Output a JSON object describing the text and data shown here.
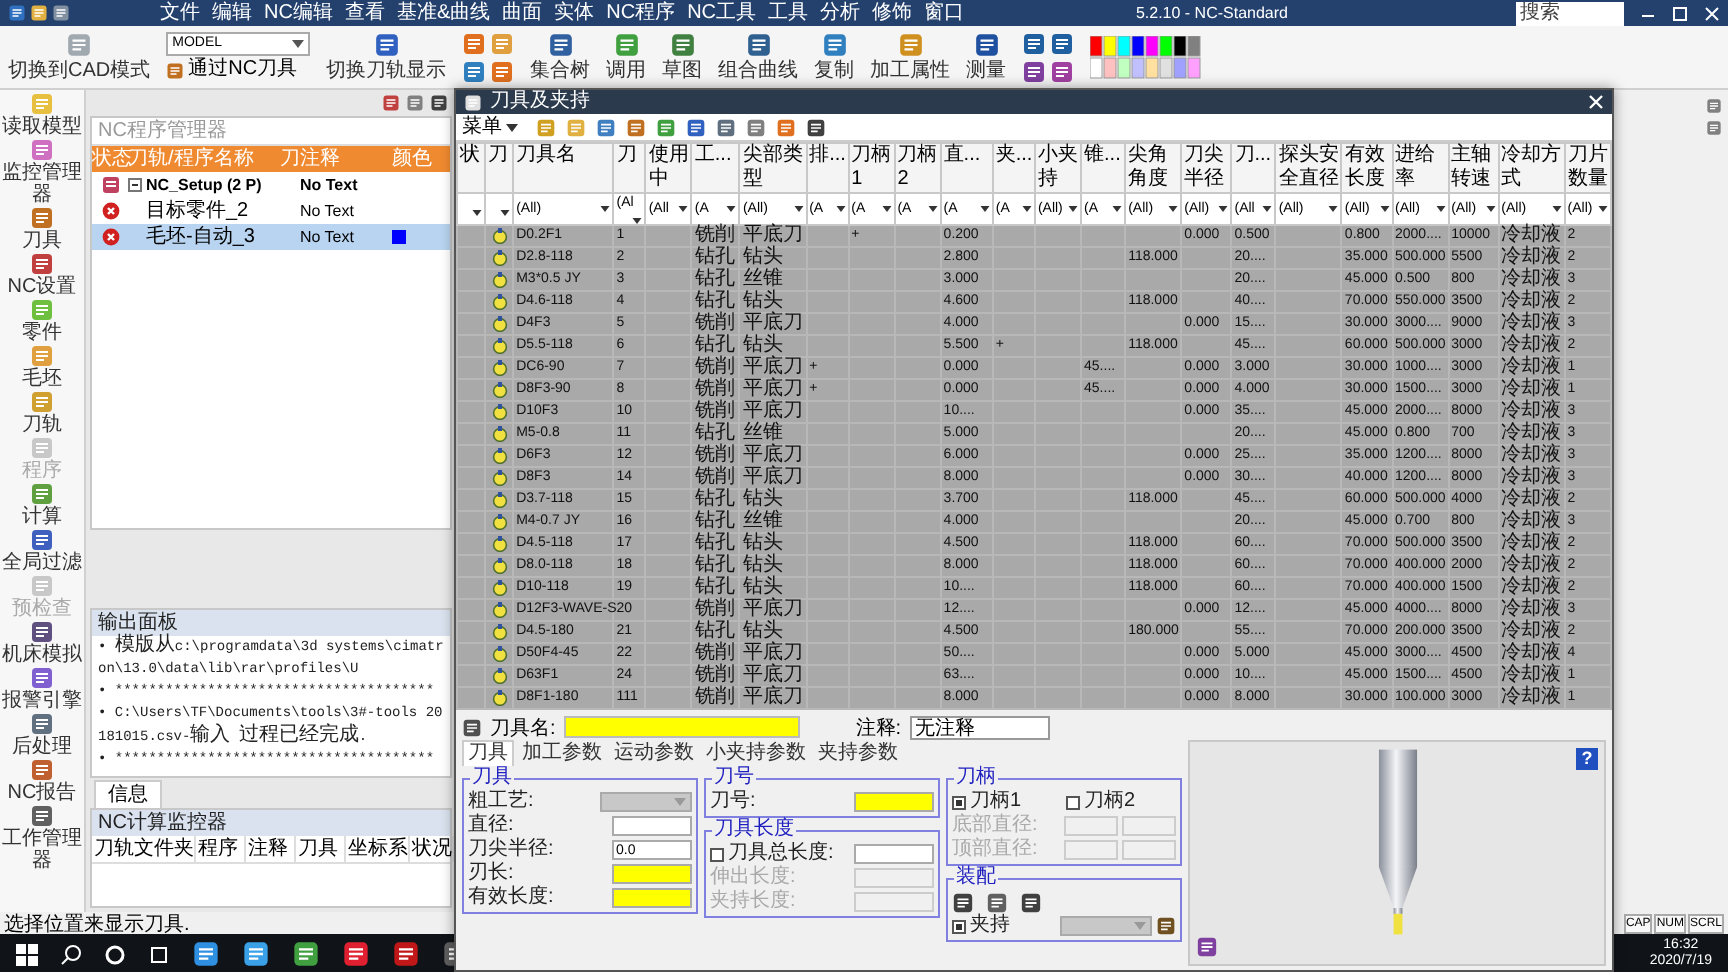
{
  "menu_bar": {
    "items": [
      "文件",
      "编辑",
      "NC编辑",
      "查看",
      "基准&曲线",
      "曲面",
      "实体",
      "NC程序",
      "NC工具",
      "工具",
      "分析",
      "修饰",
      "窗口"
    ],
    "title": "5.2.10 - NC-Standard",
    "search": {
      "placeholder": "搜索"
    }
  },
  "ribbon": {
    "cad_mode_button": "切换到CAD模式",
    "model_select": "MODEL",
    "nc_tool_button": "通过NC刀具",
    "toolpath_display_button": "切换刀轨显示",
    "buttons": [
      "集合树",
      "调用",
      "草图",
      "组合曲线",
      "复制",
      "加工属性",
      "测量"
    ]
  },
  "sidebar": {
    "items": [
      {
        "label": "读取模型",
        "disabled": false
      },
      {
        "label": "监控管理器",
        "disabled": false
      },
      {
        "label": "刀具",
        "disabled": false
      },
      {
        "label": "NC设置",
        "disabled": false
      },
      {
        "label": "零件",
        "disabled": false
      },
      {
        "label": "毛坯",
        "disabled": false
      },
      {
        "label": "刀轨",
        "disabled": false
      },
      {
        "label": "程序",
        "disabled": true
      },
      {
        "label": "计算",
        "disabled": false
      },
      {
        "label": "全局过滤",
        "disabled": false
      },
      {
        "label": "预检查",
        "disabled": true
      },
      {
        "label": "机床模拟",
        "disabled": false
      },
      {
        "label": "报警引擎",
        "disabled": false
      },
      {
        "label": "后处理",
        "disabled": false
      },
      {
        "label": "NC报告",
        "disabled": false
      },
      {
        "label": "工作管理器",
        "disabled": false
      }
    ]
  },
  "nc_program_manager": {
    "title": "NC程序管理器",
    "columns": [
      "状态",
      "刀轨/程序名称",
      "刀",
      "注释",
      "颜色"
    ],
    "rows": [
      {
        "kind": "setup",
        "name": "NC_Setup (2 P)",
        "comment": "No Text",
        "expanded": true,
        "selected": false,
        "children": [
          {
            "kind": "error",
            "name": "目标零件_2",
            "comment": "No Text",
            "selected": false
          },
          {
            "kind": "error",
            "name": "毛坯-自动_3",
            "comment": "No Text",
            "selected": true,
            "color": "#0000ff"
          }
        ]
      }
    ]
  },
  "output_panel": {
    "title": "输出面板",
    "lines": [
      "• 模版从c:\\programdata\\3d systems\\cimatron\\13.0\\data\\lib\\rar\\profiles\\U",
      "• **************************************",
      "• C:\\Users\\TF\\Documents\\tools\\3#-tools 20181015.csv-输入 过程已经完成.",
      "• **************************************"
    ]
  },
  "info_tab": {
    "label": "信息",
    "selected": true
  },
  "nc_monitor": {
    "title": "NC计算监控器",
    "columns": [
      "刀轨文件夹",
      "程序",
      "注释",
      "刀具",
      "坐标系",
      "状况"
    ]
  },
  "status_bar": {
    "message": "选择位置来显示刀具.",
    "indicators": [
      "CAP",
      "NUM",
      "SCRL"
    ]
  },
  "taskbar": {
    "time": "16:32",
    "date": "2020/7/19"
  },
  "tool_dialog": {
    "title": "刀具及夹持",
    "menu_button": "菜单",
    "table": {
      "columns": [
        {
          "label": "状"
        },
        {
          "label": "刀"
        },
        {
          "label": "刀具名",
          "filter": "(All)"
        },
        {
          "label": "刀",
          "filter": "(Al"
        },
        {
          "label": "使用中",
          "filter": "(All"
        },
        {
          "label": "工...",
          "filter": "(A"
        },
        {
          "label": "尖部类型",
          "filter": "(All)"
        },
        {
          "label": "排...",
          "filter": "(A"
        },
        {
          "label": "刀柄1",
          "filter": "(A"
        },
        {
          "label": "刀柄2",
          "filter": "(A"
        },
        {
          "label": "直...",
          "filter": "(A"
        },
        {
          "label": "夹...",
          "filter": "(A"
        },
        {
          "label": "小夹持",
          "filter": "(All)"
        },
        {
          "label": "锥...",
          "filter": "(A"
        },
        {
          "label": "尖角角度",
          "filter": "(All)"
        },
        {
          "label": "刀尖半径",
          "filter": "(All)"
        },
        {
          "label": "刀...",
          "filter": "(All"
        },
        {
          "label": "探头安全直径",
          "filter": "(All)"
        },
        {
          "label": "有效长度",
          "filter": "(All)"
        },
        {
          "label": "进给率",
          "filter": "(All)"
        },
        {
          "label": "主轴转速",
          "filter": "(All)"
        },
        {
          "label": "冷却方式",
          "filter": "(All)"
        },
        {
          "label": "刀片数量",
          "filter": "(All)"
        }
      ],
      "rows": [
        {
          "name": "D0.2F1",
          "number": "1",
          "op": "铣削",
          "tip_type": "平底刀",
          "holder_1": "+",
          "diameter": "0.200",
          "tip_radius": "0.000",
          "column_17": "0.500",
          "effective_length": "0.800",
          "feed_rate": "2000....",
          "spindle_speed": "10000",
          "coolant": "冷却液",
          "flute_count": "2"
        },
        {
          "name": "D2.8-118",
          "number": "2",
          "op": "钻孔",
          "tip_type": "钻头",
          "diameter": "2.800",
          "tip_angle": "118.000",
          "column_17": "20....",
          "effective_length": "35.000",
          "feed_rate": "500.000",
          "spindle_speed": "5500",
          "coolant": "冷却液",
          "flute_count": "2"
        },
        {
          "name": "M3*0.5 JY",
          "number": "3",
          "op": "钻孔",
          "tip_type": "丝锥",
          "diameter": "3.000",
          "column_17": "20....",
          "effective_length": "45.000",
          "feed_rate": "0.500",
          "spindle_speed": "800",
          "coolant": "冷却液",
          "flute_count": "3"
        },
        {
          "name": "D4.6-118",
          "number": "4",
          "op": "钻孔",
          "tip_type": "钻头",
          "diameter": "4.600",
          "tip_angle": "118.000",
          "column_17": "40....",
          "effective_length": "70.000",
          "feed_rate": "550.000",
          "spindle_speed": "3500",
          "coolant": "冷却液",
          "flute_count": "2"
        },
        {
          "name": "D4F3",
          "number": "5",
          "op": "铣削",
          "tip_type": "平底刀",
          "diameter": "4.000",
          "tip_radius": "0.000",
          "column_17": "15....",
          "effective_length": "30.000",
          "feed_rate": "3000....",
          "spindle_speed": "9000",
          "coolant": "冷却液",
          "flute_count": "3"
        },
        {
          "name": "D5.5-118",
          "number": "6",
          "op": "钻孔",
          "tip_type": "钻头",
          "column_12": "+",
          "diameter": "5.500",
          "tip_angle": "118.000",
          "column_17": "45....",
          "effective_length": "60.000",
          "feed_rate": "500.000",
          "spindle_speed": "3000",
          "coolant": "冷却液",
          "flute_count": "2"
        },
        {
          "name": "DC6-90",
          "number": "7",
          "op": "铣削",
          "tip_type": "平底刀",
          "column_8": "+",
          "diameter": "0.000",
          "column_14": "45....",
          "tip_radius": "0.000",
          "column_17": "3.000",
          "effective_length": "30.000",
          "feed_rate": "1000....",
          "spindle_speed": "3000",
          "coolant": "冷却液",
          "flute_count": "1"
        },
        {
          "name": "D8F3-90",
          "number": "8",
          "op": "铣削",
          "tip_type": "平底刀",
          "column_8": "+",
          "diameter": "0.000",
          "column_14": "45....",
          "tip_radius": "0.000",
          "column_17": "4.000",
          "effective_length": "30.000",
          "feed_rate": "1500....",
          "spindle_speed": "3000",
          "coolant": "冷却液",
          "flute_count": "1"
        },
        {
          "name": "D10F3",
          "number": "10",
          "op": "铣削",
          "tip_type": "平底刀",
          "diameter": "10....",
          "tip_radius": "0.000",
          "column_17": "35....",
          "effective_length": "45.000",
          "feed_rate": "2000....",
          "spindle_speed": "8000",
          "coolant": "冷却液",
          "flute_count": "3"
        },
        {
          "name": "M5-0.8",
          "number": "11",
          "op": "钻孔",
          "tip_type": "丝锥",
          "diameter": "5.000",
          "column_17": "20....",
          "effective_length": "45.000",
          "feed_rate": "0.800",
          "spindle_speed": "700",
          "coolant": "冷却液",
          "flute_count": "3"
        },
        {
          "name": "D6F3",
          "number": "12",
          "op": "铣削",
          "tip_type": "平底刀",
          "diameter": "6.000",
          "tip_radius": "0.000",
          "column_17": "25....",
          "effective_length": "35.000",
          "feed_rate": "1200....",
          "spindle_speed": "8000",
          "coolant": "冷却液",
          "flute_count": "3"
        },
        {
          "name": "D8F3",
          "number": "14",
          "op": "铣削",
          "tip_type": "平底刀",
          "diameter": "8.000",
          "tip_radius": "0.000",
          "column_17": "30....",
          "effective_length": "40.000",
          "feed_rate": "1200....",
          "spindle_speed": "8000",
          "coolant": "冷却液",
          "flute_count": "3"
        },
        {
          "name": "D3.7-118",
          "number": "15",
          "op": "钻孔",
          "tip_type": "钻头",
          "diameter": "3.700",
          "tip_angle": "118.000",
          "column_17": "45....",
          "effective_length": "60.000",
          "feed_rate": "500.000",
          "spindle_speed": "4000",
          "coolant": "冷却液",
          "flute_count": "2"
        },
        {
          "name": "M4-0.7 JY",
          "number": "16",
          "op": "钻孔",
          "tip_type": "丝锥",
          "diameter": "4.000",
          "column_17": "20....",
          "effective_length": "45.000",
          "feed_rate": "0.700",
          "spindle_speed": "800",
          "coolant": "冷却液",
          "flute_count": "3"
        },
        {
          "name": "D4.5-118",
          "number": "17",
          "op": "钻孔",
          "tip_type": "钻头",
          "diameter": "4.500",
          "tip_angle": "118.000",
          "column_17": "60....",
          "effective_length": "70.000",
          "feed_rate": "500.000",
          "spindle_speed": "3500",
          "coolant": "冷却液",
          "flute_count": "2"
        },
        {
          "name": "D8.0-118",
          "number": "18",
          "op": "钻孔",
          "tip_type": "钻头",
          "diameter": "8.000",
          "tip_angle": "118.000",
          "column_17": "60....",
          "effective_length": "70.000",
          "feed_rate": "400.000",
          "spindle_speed": "2000",
          "coolant": "冷却液",
          "flute_count": "2"
        },
        {
          "name": "D10-118",
          "number": "19",
          "op": "钻孔",
          "tip_type": "钻头",
          "diameter": "10....",
          "tip_angle": "118.000",
          "column_17": "60....",
          "effective_length": "70.000",
          "feed_rate": "400.000",
          "spindle_speed": "1500",
          "coolant": "冷却液",
          "flute_count": "2"
        },
        {
          "name": "D12F3-WAVE-S",
          "number": "20",
          "op": "铣削",
          "tip_type": "平底刀",
          "diameter": "12....",
          "tip_radius": "0.000",
          "column_17": "12....",
          "effective_length": "45.000",
          "feed_rate": "4000....",
          "spindle_speed": "8000",
          "coolant": "冷却液",
          "flute_count": "3"
        },
        {
          "name": "D4.5-180",
          "number": "21",
          "op": "钻孔",
          "tip_type": "钻头",
          "diameter": "4.500",
          "tip_angle": "180.000",
          "column_17": "55....",
          "effective_length": "70.000",
          "feed_rate": "200.000",
          "spindle_speed": "3500",
          "coolant": "冷却液",
          "flute_count": "2"
        },
        {
          "name": "D50F4-45",
          "number": "22",
          "op": "铣削",
          "tip_type": "平底刀",
          "diameter": "50....",
          "tip_radius": "0.000",
          "column_17": "5.000",
          "effective_length": "45.000",
          "feed_rate": "3000....",
          "spindle_speed": "4500",
          "coolant": "冷却液",
          "flute_count": "4"
        },
        {
          "name": "D63F1",
          "number": "24",
          "op": "铣削",
          "tip_type": "平底刀",
          "diameter": "63....",
          "tip_radius": "0.000",
          "column_17": "10....",
          "effective_length": "45.000",
          "feed_rate": "1500....",
          "spindle_speed": "4500",
          "coolant": "冷却液",
          "flute_count": "1"
        },
        {
          "name": "D8F1-180",
          "number": "111",
          "op": "铣削",
          "tip_type": "平底刀",
          "diameter": "8.000",
          "tip_radius": "0.000",
          "column_17": "8.000",
          "effective_length": "30.000",
          "feed_rate": "100.000",
          "spindle_speed": "3000",
          "coolant": "冷却液",
          "flute_count": "1"
        }
      ]
    },
    "tool_name": {
      "label": "刀具名:",
      "required": true
    },
    "comment": {
      "label": "注释:",
      "value": "无注释"
    },
    "tabs": [
      {
        "label": "刀具",
        "selected": true
      },
      {
        "label": "加工参数",
        "selected": false
      },
      {
        "label": "运动参数",
        "selected": false
      },
      {
        "label": "小夹持参数",
        "selected": false
      },
      {
        "label": "夹持参数",
        "selected": false
      }
    ],
    "groups": {
      "tool": {
        "title": "刀具",
        "fields": [
          {
            "kind": "select",
            "label": "粗工艺:",
            "disabled": true,
            "required": false
          },
          {
            "kind": "input",
            "label": "直径:",
            "disabled": false,
            "required": false
          },
          {
            "kind": "input",
            "label": "刀尖半径:",
            "value": "0.0",
            "disabled": false,
            "required": false
          },
          {
            "kind": "input",
            "label": "刃长:",
            "disabled": false,
            "required": true
          },
          {
            "kind": "input",
            "label": "有效长度:",
            "disabled": false,
            "required": true
          }
        ]
      },
      "tool_number": {
        "title": "刀号",
        "fields": [
          {
            "kind": "input",
            "label": "刀号:",
            "disabled": false,
            "required": true
          }
        ]
      },
      "tool_length": {
        "title": "刀具长度",
        "fields": [
          {
            "kind": "checkbox_input",
            "label": "刀具总长度:",
            "checked": false,
            "disabled": false,
            "required": false
          },
          {
            "kind": "input",
            "label": "伸出长度:",
            "disabled": true,
            "required": false
          },
          {
            "kind": "input",
            "label": "夹持长度:",
            "disabled": true,
            "required": false
          }
        ]
      },
      "holder": {
        "title": "刀柄",
        "fields": [
          {
            "kind": "checkbox_pair",
            "items": [
              {
                "label": "刀柄1",
                "checked": true
              },
              {
                "label": "刀柄2",
                "checked": false
              }
            ]
          },
          {
            "kind": "double_input",
            "label": "底部直径:",
            "disabled": true
          },
          {
            "kind": "double_input",
            "label": "顶部直径:",
            "disabled": true
          }
        ]
      },
      "assembly": {
        "title": "装配",
        "fields": [
          {
            "kind": "icons"
          },
          {
            "kind": "checkbox_select",
            "label": "夹持",
            "checked": true,
            "disabled": true
          }
        ]
      }
    },
    "help_button": "?"
  }
}
